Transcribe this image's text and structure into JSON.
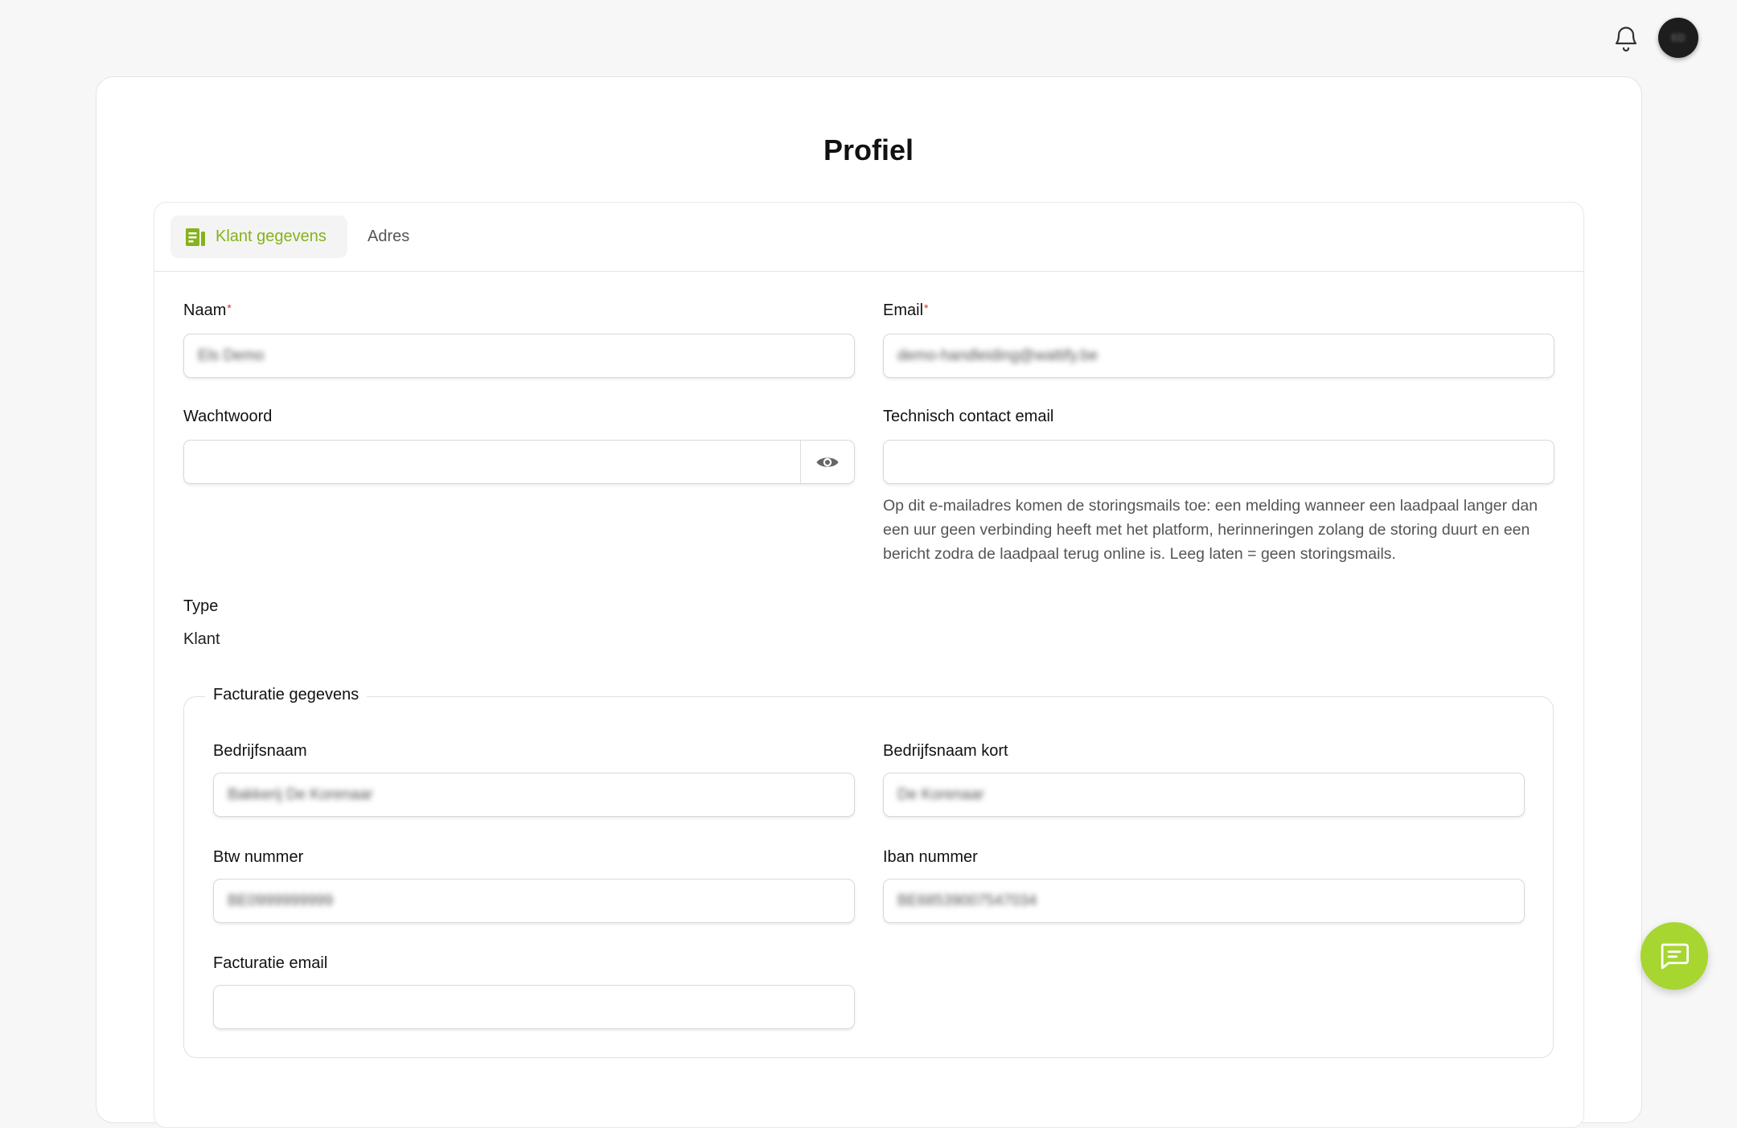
{
  "page": {
    "title": "Profiel"
  },
  "header": {
    "avatar_initials": "ED"
  },
  "tabs": [
    {
      "label": "Klant gegevens",
      "active": true,
      "icon": "document-icon"
    },
    {
      "label": "Adres",
      "active": false
    }
  ],
  "form": {
    "naam": {
      "label": "Naam",
      "required_marker": "*",
      "value": "Els Demo"
    },
    "email": {
      "label": "Email",
      "required_marker": "*",
      "value": "demo-handleiding@wattify.be"
    },
    "wachtwoord": {
      "label": "Wachtwoord",
      "value": ""
    },
    "technisch_contact_email": {
      "label": "Technisch contact email",
      "value": "",
      "help": "Op dit e-mailadres komen de storingsmails toe: een melding wanneer een laadpaal langer dan een uur geen verbinding heeft met het platform, herinneringen zolang de storing duurt en een bericht zodra de laadpaal terug online is. Leeg laten = geen storingsmails."
    },
    "type": {
      "label": "Type",
      "value": "Klant"
    }
  },
  "billing": {
    "legend": "Facturatie gegevens",
    "bedrijfsnaam": {
      "label": "Bedrijfsnaam",
      "value": "Bakkerij De Korenaar"
    },
    "bedrijfsnaam_kort": {
      "label": "Bedrijfsnaam kort",
      "value": "De Korenaar"
    },
    "btw_nummer": {
      "label": "Btw nummer",
      "value": "BE0999999999"
    },
    "iban_nummer": {
      "label": "Iban nummer",
      "value": "BE68539007547034"
    },
    "facturatie_email": {
      "label": "Facturatie email",
      "value": ""
    }
  },
  "icons": {
    "notifications": "bell-icon",
    "password_toggle": "eye-icon",
    "chat": "chat-bubble-icon"
  },
  "colors": {
    "accent": "#86b21b",
    "fab": "#a6d62f",
    "required": "#d6302b"
  }
}
